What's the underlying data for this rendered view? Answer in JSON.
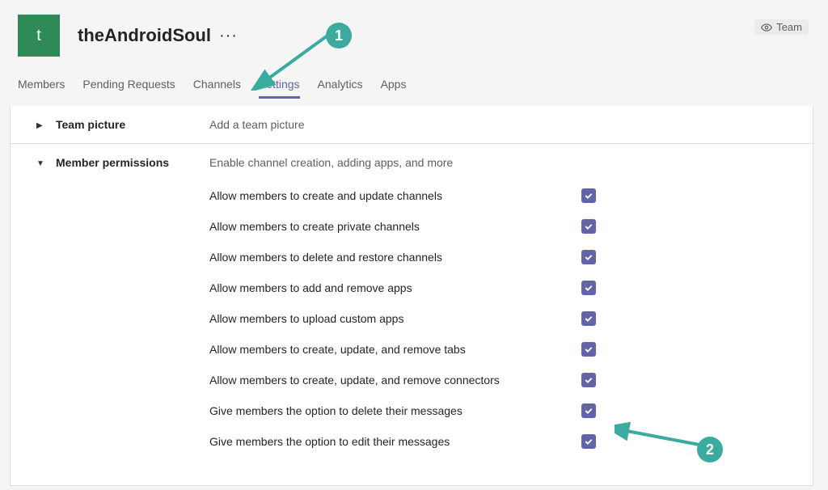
{
  "team": {
    "avatar_letter": "t",
    "name": "theAndroidSoul",
    "badge_label": "Team"
  },
  "tabs": {
    "members": "Members",
    "pending": "Pending Requests",
    "channels": "Channels",
    "settings": "Settings",
    "analytics": "Analytics",
    "apps": "Apps"
  },
  "sections": {
    "team_picture": {
      "title": "Team picture",
      "desc": "Add a team picture"
    },
    "member_permissions": {
      "title": "Member permissions",
      "desc": "Enable channel creation, adding apps, and more",
      "items": [
        {
          "label": "Allow members to create and update channels",
          "checked": true
        },
        {
          "label": "Allow members to create private channels",
          "checked": true
        },
        {
          "label": "Allow members to delete and restore channels",
          "checked": true
        },
        {
          "label": "Allow members to add and remove apps",
          "checked": true
        },
        {
          "label": "Allow members to upload custom apps",
          "checked": true
        },
        {
          "label": "Allow members to create, update, and remove tabs",
          "checked": true
        },
        {
          "label": "Allow members to create, update, and remove connectors",
          "checked": true
        },
        {
          "label": "Give members the option to delete their messages",
          "checked": true
        },
        {
          "label": "Give members the option to edit their messages",
          "checked": true
        }
      ]
    }
  },
  "annotations": {
    "badge1": "1",
    "badge2": "2"
  }
}
